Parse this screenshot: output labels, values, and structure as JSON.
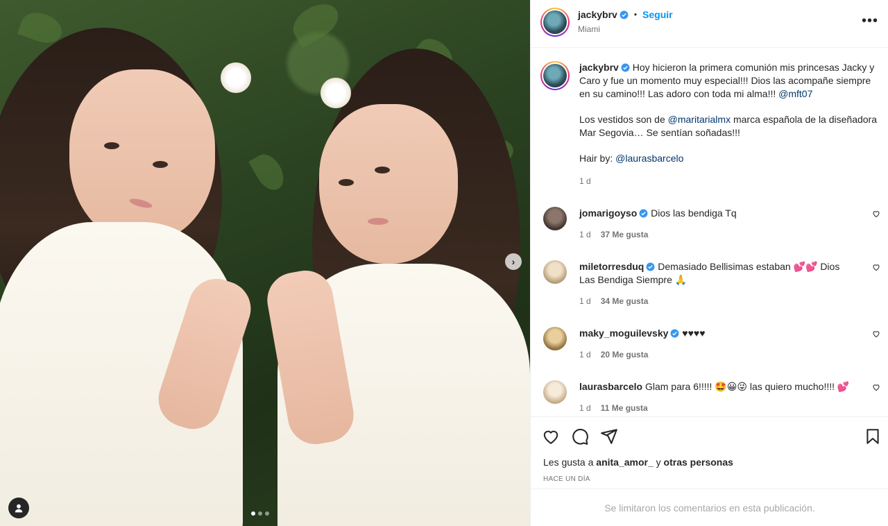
{
  "post": {
    "author": "jackybrv",
    "follow_label": "Seguir",
    "separator": "•",
    "location": "Miami",
    "more_label": "•••"
  },
  "caption": {
    "username": "jackybrv",
    "text_1": "Hoy hicieron la primera comunión mis princesas Jacky y Caro y fue un momento muy especial!!! Dios las acompañe siempre en su camino!!! Las adoro con toda mi alma!!! ",
    "mention_1": "@mft07",
    "text_2a": "Los vestidos son de ",
    "mention_2": "@maritarialmx",
    "text_2b": " marca española de la diseñadora Mar Segovia… Se sentían soñadas!!!",
    "text_3": "Hair by: ",
    "mention_3": "@laurasbarcelo",
    "time": "1 d"
  },
  "comments": [
    {
      "username": "jomarigoyso",
      "text": "Dios las bendiga Tq",
      "time": "1 d",
      "likes": "37 Me gusta",
      "avatar_color": "#5a4a42"
    },
    {
      "username": "miletorresduq",
      "text": "Demasiado Bellisimas estaban 💕💕 Dios Las Bendiga Siempre 🙏",
      "time": "1 d",
      "likes": "34 Me gusta",
      "avatar_color": "#d8c4a8"
    },
    {
      "username": "maky_moguilevsky",
      "text": "♥♥♥♥",
      "time": "1 d",
      "likes": "20 Me gusta",
      "avatar_color": "#c9a873"
    },
    {
      "username": "laurasbarcelo",
      "text": "Glam para 6!!!!! 🤩😀😜 las quiero mucho!!!! 💕",
      "time": "1 d",
      "likes": "11 Me gusta",
      "avatar_color": "#e2d3bf"
    }
  ],
  "likes": {
    "prefix": "Les gusta a ",
    "user": "anita_amor_",
    "middle": " y ",
    "others": "otras personas"
  },
  "date": "HACE UN DÍA",
  "comments_limited": "Se limitaron los comentarios en esta publicación.",
  "carousel": {
    "current": 1,
    "total": 3,
    "next_icon": "chevron-right-icon"
  },
  "colors": {
    "accent": "#0095f6",
    "mention": "#00376b",
    "muted": "#737373",
    "verified": "#3897f0"
  }
}
